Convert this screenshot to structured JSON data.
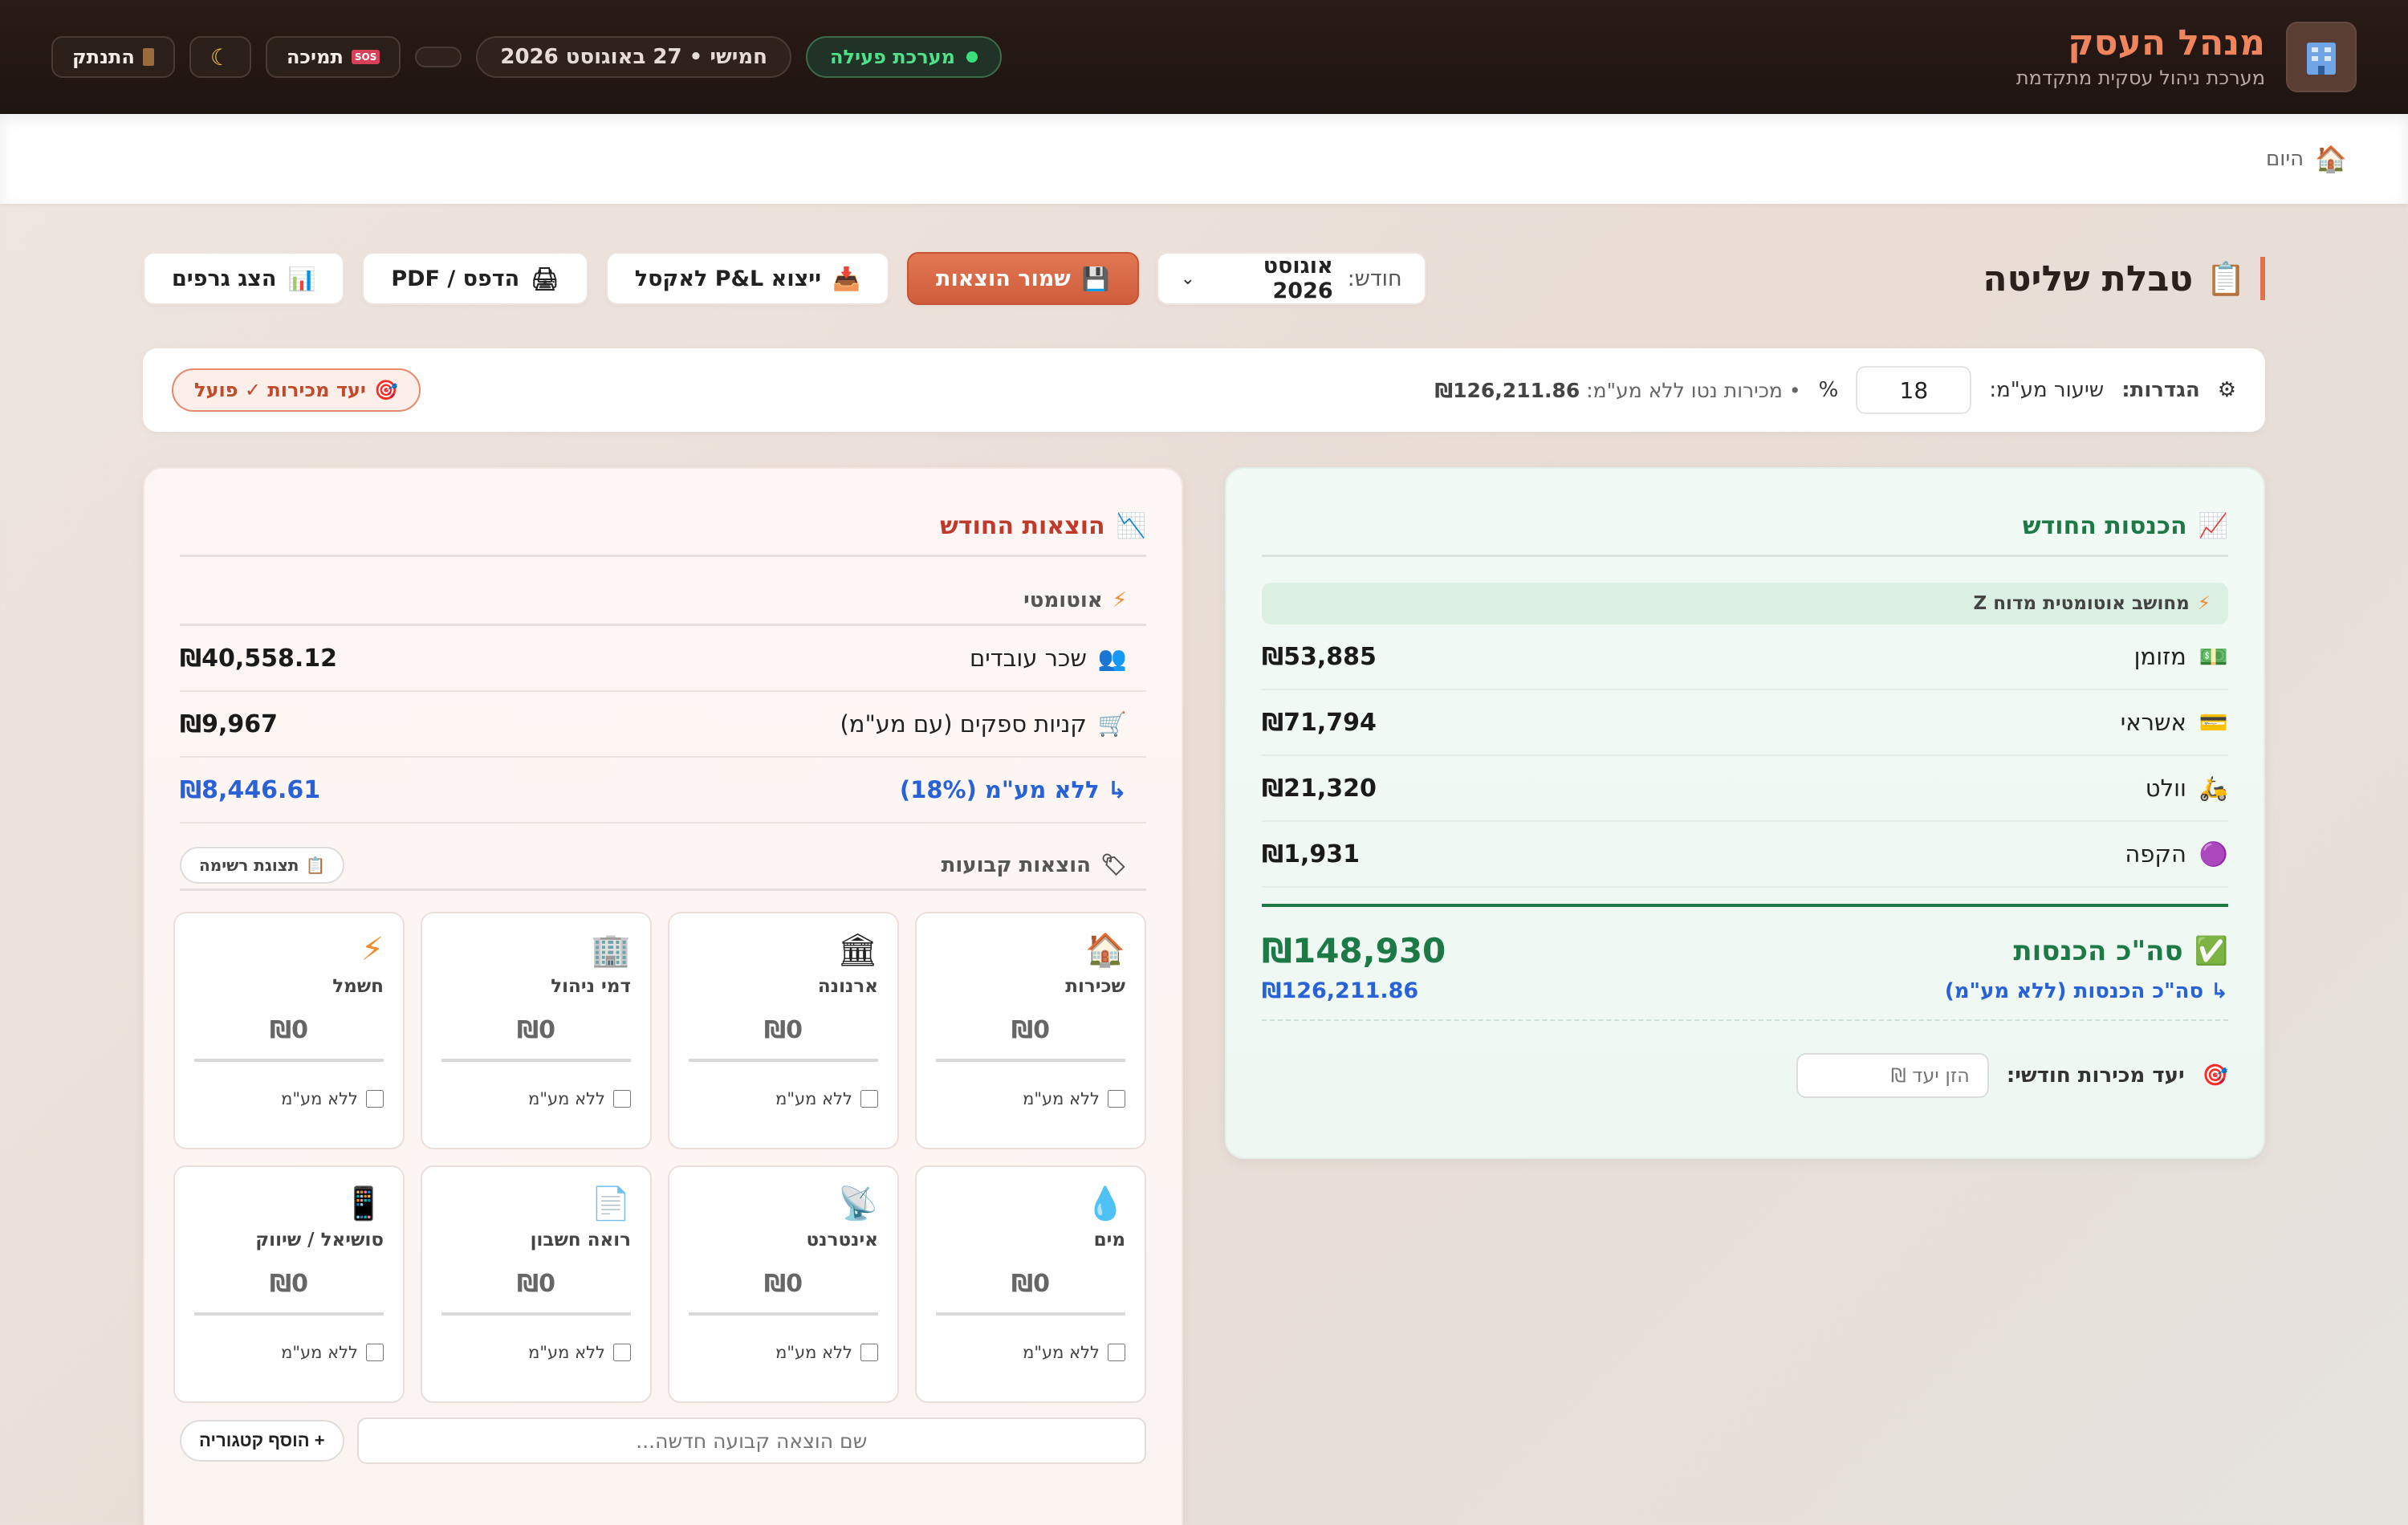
{
  "header": {
    "title": "מנהל העסק",
    "subtitle": "מערכת ניהול עסקית מתקדמת",
    "status": "מערכת פעילה",
    "date": "חמישי • 27 באוגוסט 2026",
    "support_label": "תמיכה",
    "logout_label": "התנתק"
  },
  "breadcrumb": {
    "label": "היום"
  },
  "page": {
    "title": "טבלת שליטה",
    "month_label": "חודש:",
    "month_value": "אוגוסט 2026",
    "save_label": "שמור הוצאות",
    "export_label": "ייצוא P&L לאקסל",
    "print_label": "הדפס / PDF",
    "charts_label": "הצג גרפים"
  },
  "settings": {
    "label": "הגדרות:",
    "vat_label": "שיעור מע\"מ:",
    "vat_value": "18",
    "vat_unit": "%",
    "net_sales_label": "• מכירות נטו ללא מע\"מ:",
    "net_sales_value": "₪126,211.86",
    "goal_badge": "יעד מכירות ✓ פועל"
  },
  "income": {
    "title": "הכנסות החודש",
    "auto_note": "מחושב אוטומטית מדוח Z",
    "rows": [
      {
        "name": "מזומן",
        "value": "₪53,885",
        "icon": "cash-icon"
      },
      {
        "name": "אשראי",
        "value": "₪71,794",
        "icon": "credit-card-icon"
      },
      {
        "name": "וולט",
        "value": "₪21,320",
        "icon": "scooter-icon"
      },
      {
        "name": "הקפה",
        "value": "₪1,931",
        "icon": "coin-icon"
      }
    ],
    "total_label": "סה\"כ הכנסות",
    "total_value": "₪148,930",
    "net_label": "↳ סה\"כ הכנסות (ללא מע\"מ)",
    "net_value": "₪126,211.86",
    "goal_label": "יעד מכירות חודשי:",
    "goal_placeholder": "הזן יעד ₪"
  },
  "expenses": {
    "title": "הוצאות החודש",
    "auto_title": "אוטומטי",
    "rows": [
      {
        "name": "שכר עובדים",
        "value": "₪40,558.12",
        "icon": "people-icon"
      },
      {
        "name": "קניות ספקים (עם מע\"מ)",
        "value": "₪9,967",
        "icon": "cart-icon"
      },
      {
        "name": "↳ ללא מע\"מ (18%)",
        "value": "₪8,446.61",
        "icon": ""
      }
    ],
    "fixed_title": "הוצאות קבועות",
    "list_view_label": "תצוגת רשימה",
    "no_vat_label": "ללא מע\"מ",
    "tiles": [
      {
        "name": "שכירות",
        "value": "₪0",
        "icon": "house-icon"
      },
      {
        "name": "ארנונה",
        "value": "₪0",
        "icon": "bank-icon"
      },
      {
        "name": "דמי ניהול",
        "value": "₪0",
        "icon": "building-icon"
      },
      {
        "name": "חשמל",
        "value": "₪0",
        "icon": "lightning-icon"
      },
      {
        "name": "מים",
        "value": "₪0",
        "icon": "droplet-icon"
      },
      {
        "name": "אינטרנט",
        "value": "₪0",
        "icon": "satellite-icon"
      },
      {
        "name": "רואה חשבון",
        "value": "₪0",
        "icon": "document-icon"
      },
      {
        "name": "סושיאל / שיווק",
        "value": "₪0",
        "icon": "phone-icon"
      }
    ],
    "new_placeholder": "שם הוצאה קבועה חדשה...",
    "add_category_label": "+ הוסף קטגוריה"
  }
}
